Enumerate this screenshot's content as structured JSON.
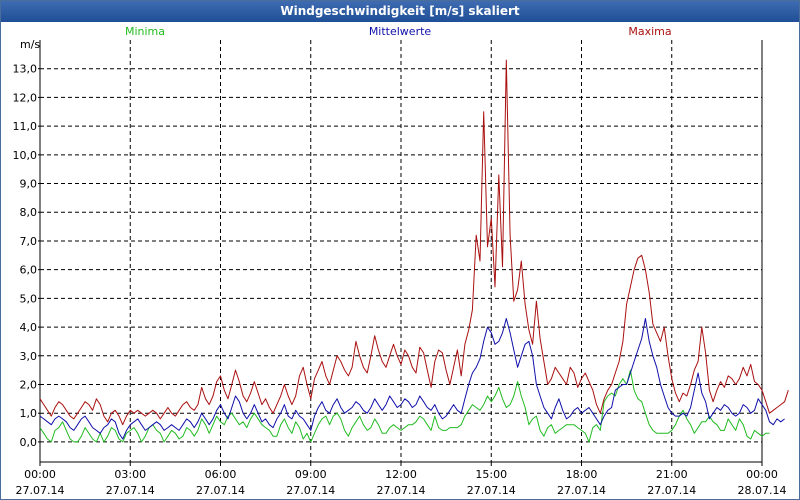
{
  "chart_data": {
    "type": "line",
    "title": "Windgeschwindigkeit [m/s] skaliert",
    "ylabel": "m/s",
    "ylim": [
      -0.7,
      14.0
    ],
    "yticks": [
      "0,0",
      "1,0",
      "2,0",
      "3,0",
      "4,0",
      "5,0",
      "6,0",
      "7,0",
      "8,0",
      "9,0",
      "10,0",
      "11,0",
      "12,0",
      "13,0"
    ],
    "xlim": [
      0,
      24
    ],
    "xticks": [
      {
        "time": "00:00",
        "date": "27.07.14"
      },
      {
        "time": "03:00",
        "date": "27.07.14"
      },
      {
        "time": "06:00",
        "date": "27.07.14"
      },
      {
        "time": "09:00",
        "date": "27.07.14"
      },
      {
        "time": "12:00",
        "date": "27.07.14"
      },
      {
        "time": "15:00",
        "date": "27.07.14"
      },
      {
        "time": "18:00",
        "date": "27.07.14"
      },
      {
        "time": "21:00",
        "date": "27.07.14"
      },
      {
        "time": "00:00",
        "date": "28.07.14"
      }
    ],
    "grid": true,
    "legend": "top",
    "x_step_hours": 0.125,
    "series": [
      {
        "name": "Minima",
        "color": "#22bb22",
        "values": [
          0.5,
          0.3,
          0.1,
          0.0,
          0.4,
          0.5,
          0.7,
          0.4,
          0.1,
          0.0,
          0.0,
          0.2,
          0.5,
          0.3,
          0.1,
          0.0,
          0.3,
          0.0,
          0.2,
          0.5,
          0.4,
          0.1,
          0.0,
          0.3,
          0.4,
          0.5,
          0.3,
          0.0,
          0.2,
          0.5,
          0.6,
          0.4,
          0.3,
          0.0,
          0.2,
          0.4,
          0.3,
          0.1,
          0.2,
          0.5,
          0.4,
          0.2,
          0.4,
          0.8,
          0.6,
          0.3,
          0.6,
          0.9,
          0.7,
          0.6,
          0.9,
          1.0,
          0.8,
          0.6,
          0.7,
          0.5,
          0.8,
          1.0,
          0.8,
          0.6,
          0.5,
          0.4,
          0.2,
          0.2,
          0.6,
          0.8,
          0.5,
          0.3,
          0.7,
          0.5,
          0.1,
          0.3,
          0.0,
          0.3,
          0.6,
          0.8,
          0.9,
          0.6,
          0.9,
          1.0,
          0.8,
          0.4,
          0.2,
          0.5,
          0.7,
          0.9,
          0.6,
          0.4,
          0.5,
          0.8,
          0.6,
          0.3,
          0.3,
          0.5,
          0.6,
          0.5,
          0.4,
          0.5,
          0.6,
          0.6,
          0.7,
          0.9,
          0.8,
          0.6,
          0.4,
          0.9,
          0.5,
          0.4,
          0.4,
          0.5,
          0.5,
          0.5,
          0.6,
          0.9,
          1.1,
          1.3,
          1.2,
          1.1,
          1.3,
          1.6,
          1.4,
          1.6,
          1.9,
          1.5,
          1.2,
          1.3,
          1.6,
          2.1,
          1.6,
          1.2,
          0.6,
          0.8,
          0.9,
          0.4,
          0.2,
          0.5,
          0.6,
          0.3,
          0.4,
          0.5,
          0.6,
          0.6,
          0.6,
          0.5,
          0.4,
          0.3,
          0.0,
          0.5,
          0.6,
          0.4,
          1.4,
          1.6,
          1.7,
          1.6,
          2.0,
          2.2,
          2.0,
          2.5,
          1.8,
          1.5,
          1.4,
          1.0,
          0.6,
          0.4,
          0.3,
          0.3,
          0.3,
          0.3,
          0.4,
          0.6,
          0.9,
          1.1,
          0.8,
          0.6,
          0.3,
          0.5,
          0.7,
          0.7,
          0.9,
          0.7,
          0.6,
          0.4,
          0.4,
          0.8,
          0.6,
          0.4,
          0.8,
          0.6,
          0.2,
          0.1,
          0.4,
          0.3,
          0.2,
          0.3,
          0.3
        ]
      },
      {
        "name": "Mittelwerte",
        "color": "#1010aa",
        "values": [
          0.9,
          0.8,
          0.7,
          0.6,
          0.8,
          0.9,
          0.8,
          0.7,
          0.5,
          0.4,
          0.6,
          0.8,
          0.9,
          0.7,
          0.5,
          0.4,
          0.3,
          0.5,
          0.6,
          0.8,
          0.7,
          0.3,
          0.1,
          0.4,
          0.6,
          0.7,
          0.8,
          0.6,
          0.4,
          0.5,
          0.6,
          0.7,
          0.6,
          0.4,
          0.5,
          0.6,
          0.5,
          0.4,
          0.6,
          0.8,
          0.7,
          0.5,
          0.7,
          1.0,
          0.8,
          0.6,
          0.8,
          1.1,
          1.3,
          1.0,
          0.8,
          1.2,
          1.6,
          1.4,
          1.0,
          0.8,
          1.0,
          1.3,
          1.0,
          0.7,
          0.8,
          0.6,
          0.5,
          0.8,
          1.0,
          1.3,
          0.9,
          0.8,
          1.1,
          0.9,
          0.8,
          0.6,
          0.4,
          0.9,
          1.2,
          1.4,
          1.1,
          1.0,
          1.3,
          1.5,
          1.2,
          1.0,
          1.1,
          1.2,
          1.4,
          1.3,
          1.1,
          1.0,
          1.2,
          1.5,
          1.3,
          1.1,
          1.3,
          1.6,
          1.4,
          1.2,
          1.3,
          1.5,
          1.4,
          1.2,
          1.3,
          1.6,
          1.4,
          1.2,
          1.1,
          1.3,
          1.0,
          0.8,
          0.9,
          1.1,
          1.3,
          1.1,
          1.0,
          1.5,
          2.0,
          2.4,
          2.6,
          2.9,
          3.5,
          4.0,
          3.8,
          3.4,
          3.5,
          3.8,
          4.3,
          3.8,
          3.2,
          2.6,
          3.0,
          3.4,
          3.5,
          3.0,
          2.0,
          1.6,
          1.2,
          1.0,
          0.8,
          1.2,
          1.5,
          1.1,
          0.8,
          0.9,
          1.1,
          1.2,
          1.0,
          1.1,
          1.2,
          1.0,
          0.8,
          0.6,
          0.9,
          1.1,
          1.2,
          1.8,
          1.9,
          2.0,
          2.0,
          2.4,
          2.8,
          3.2,
          3.6,
          4.3,
          3.5,
          3.0,
          2.6,
          2.0,
          1.6,
          1.2,
          1.0,
          0.9,
          0.9,
          1.0,
          0.9,
          1.2,
          1.8,
          2.4,
          1.7,
          1.4,
          0.8,
          1.0,
          1.2,
          1.1,
          1.3,
          1.2,
          1.0,
          0.9,
          1.0,
          1.3,
          1.2,
          1.0,
          1.1,
          1.5,
          1.3,
          1.1,
          0.7,
          0.6,
          0.8,
          0.7,
          0.8
        ]
      },
      {
        "name": "Maxima",
        "color": "#aa1010",
        "values": [
          1.5,
          1.3,
          1.1,
          0.9,
          1.2,
          1.4,
          1.3,
          1.1,
          0.9,
          0.8,
          1.0,
          1.2,
          1.4,
          1.3,
          1.1,
          1.5,
          1.3,
          0.9,
          0.7,
          1.0,
          1.1,
          0.9,
          0.6,
          0.9,
          1.1,
          1.0,
          1.1,
          1.0,
          0.9,
          1.0,
          1.1,
          1.0,
          0.8,
          1.0,
          1.2,
          1.0,
          0.9,
          1.1,
          1.3,
          1.4,
          1.2,
          1.1,
          1.3,
          1.9,
          1.5,
          1.3,
          1.6,
          2.1,
          2.3,
          1.8,
          1.5,
          2.0,
          2.5,
          2.1,
          1.6,
          1.4,
          1.7,
          2.1,
          1.7,
          1.3,
          1.5,
          1.2,
          1.0,
          1.3,
          1.6,
          2.0,
          1.6,
          1.3,
          1.6,
          2.3,
          2.6,
          2.0,
          1.5,
          2.2,
          2.5,
          2.8,
          2.3,
          2.0,
          2.5,
          3.0,
          2.8,
          2.5,
          2.3,
          2.6,
          3.5,
          3.0,
          2.6,
          2.4,
          3.0,
          3.7,
          3.2,
          2.8,
          2.6,
          3.0,
          3.4,
          3.0,
          2.7,
          3.2,
          3.0,
          2.6,
          2.4,
          3.3,
          3.1,
          2.5,
          1.9,
          2.8,
          3.2,
          3.1,
          2.5,
          2.0,
          2.6,
          3.2,
          2.3,
          3.4,
          3.9,
          4.6,
          7.2,
          6.3,
          11.5,
          6.8,
          7.8,
          5.4,
          9.3,
          6.1,
          13.3,
          7.2,
          4.9,
          5.3,
          6.3,
          4.8,
          3.9,
          3.4,
          4.9,
          3.6,
          2.8,
          2.0,
          2.2,
          2.6,
          2.4,
          2.2,
          2.0,
          2.6,
          2.4,
          1.9,
          2.2,
          2.4,
          2.1,
          1.8,
          1.3,
          1.0,
          1.5,
          1.8,
          2.0,
          2.4,
          2.8,
          3.5,
          4.8,
          5.4,
          6.0,
          6.4,
          6.5,
          6.0,
          5.2,
          4.1,
          3.8,
          3.5,
          4.0,
          3.0,
          2.2,
          1.7,
          1.4,
          1.7,
          1.6,
          2.0,
          2.5,
          2.8,
          4.0,
          3.1,
          1.8,
          1.4,
          1.8,
          2.1,
          1.9,
          2.3,
          2.2,
          2.0,
          2.2,
          2.6,
          2.3,
          2.7,
          2.1,
          2.0,
          1.8,
          1.4,
          1.0,
          1.1,
          1.2,
          1.3,
          1.4,
          1.8
        ]
      }
    ]
  }
}
